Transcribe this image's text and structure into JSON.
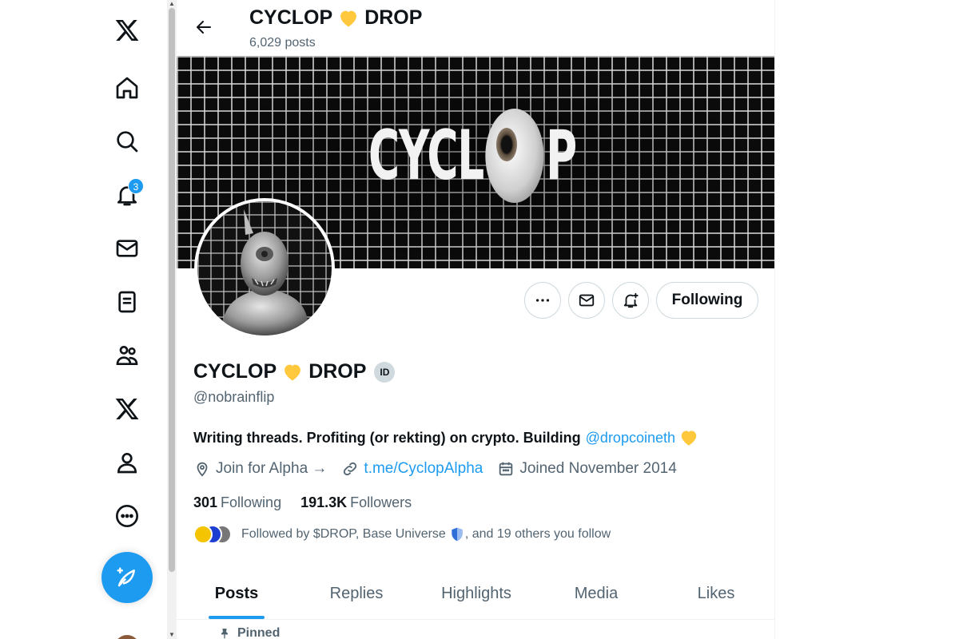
{
  "colors": {
    "accent": "#1d9bf0",
    "text": "#0f1419",
    "muted": "#536471",
    "heart": "#ffc83d"
  },
  "nav": {
    "items": [
      {
        "icon": "x-logo-icon"
      },
      {
        "icon": "home-icon"
      },
      {
        "icon": "search-icon"
      },
      {
        "icon": "notifications-icon",
        "badge": "3"
      },
      {
        "icon": "messages-icon"
      },
      {
        "icon": "lists-icon"
      },
      {
        "icon": "communities-icon"
      },
      {
        "icon": "premium-x-icon"
      },
      {
        "icon": "profile-icon"
      },
      {
        "icon": "more-icon"
      }
    ],
    "compose_icon": "compose-post-icon"
  },
  "header": {
    "title": "CYCLOP",
    "title_suffix": "DROP",
    "post_count": "6,029 posts"
  },
  "banner": {
    "word_left": "CYCL",
    "word_right": "P"
  },
  "actions": {
    "more_icon": "more-horizontal-icon",
    "message_icon": "message-icon",
    "notify_icon": "notify-bell-icon",
    "follow_label": "Following"
  },
  "profile": {
    "name": "CYCLOP",
    "name_suffix": "DROP",
    "id_badge": "ID",
    "handle": "@nobrainflip",
    "bio": "Writing threads. Profiting (or rekting) on crypto. Building",
    "bio_mention": "@dropcoineth",
    "location": "Join for Alpha →",
    "link": "t.me/CyclopAlpha",
    "joined": "Joined November 2014",
    "following_count": "301",
    "following_label": "Following",
    "followers_count": "191.3K",
    "followers_label": "Followers",
    "followed_by_pre": "Followed by $DROP, Base Universe",
    "followed_by_post": ", and 19 others you follow"
  },
  "tabs": [
    {
      "label": "Posts",
      "active": true
    },
    {
      "label": "Replies",
      "active": false
    },
    {
      "label": "Highlights",
      "active": false
    },
    {
      "label": "Media",
      "active": false
    },
    {
      "label": "Likes",
      "active": false
    }
  ],
  "pinned_label": "Pinned"
}
